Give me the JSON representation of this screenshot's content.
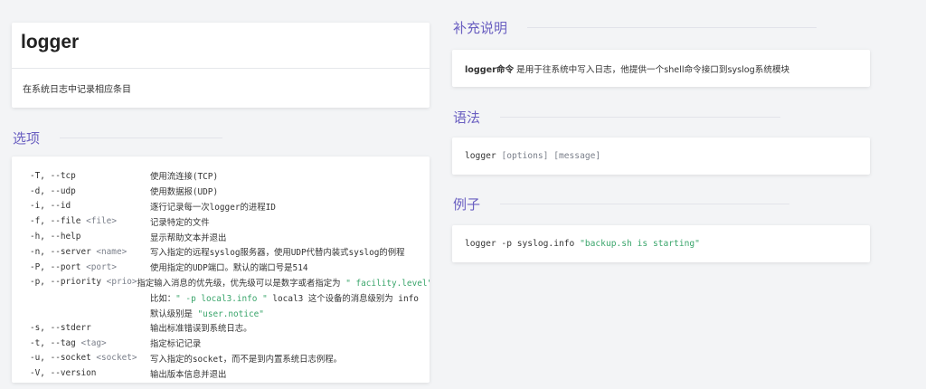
{
  "command": {
    "name": "logger",
    "description": "在系统日志中记录相应条目"
  },
  "sections": {
    "options": "选项",
    "supplement": "补充说明",
    "syntax": "语法",
    "example": "例子"
  },
  "supplement": {
    "bold": "logger命令",
    "text": " 是用于往系统中写入日志，他提供一个shell命令接口到syslog系统模块"
  },
  "syntax": {
    "cmd": "logger ",
    "arg1": "[options]",
    "sep": " ",
    "arg2": "[message]"
  },
  "example": {
    "cmd": "logger -p syslog.info ",
    "str": "\"backup.sh is starting\""
  },
  "options": [
    {
      "flag": "-T, --tcp",
      "arg": "",
      "text": "使用流连接(TCP)"
    },
    {
      "flag": "-d, --udp",
      "arg": "",
      "text": "使用数据报(UDP)"
    },
    {
      "flag": "-i, --id",
      "arg": "",
      "text": "逐行记录每一次logger的进程ID"
    },
    {
      "flag": "-f, --file ",
      "arg": "<file>",
      "text": "记录特定的文件"
    },
    {
      "flag": "-h, --help",
      "arg": "",
      "text": "显示帮助文本并退出"
    },
    {
      "flag": "-n, --server ",
      "arg": "<name>",
      "text": "写入指定的远程syslog服务器，使用UDP代替内装式syslog的例程"
    },
    {
      "flag": "-P, --port ",
      "arg": "<port>",
      "text": "使用指定的UDP端口。默认的端口号是514"
    },
    {
      "flag": "-p, --priority ",
      "arg": "<prio>",
      "text": "指定输入消息的优先级，优先级可以是数字或者指定为 ",
      "str": "\" facility.level\""
    },
    {
      "flag": "",
      "arg": "",
      "text": "比如：",
      "str": "\" -p local3.info \"",
      "text2": " local3 这个设备的消息级别为 info"
    },
    {
      "flag": "",
      "arg": "",
      "text": "默认级别是 ",
      "str": "\"user.notice\""
    },
    {
      "flag": "-s, --stderr",
      "arg": "",
      "text": "输出标准错误到系统日志。"
    },
    {
      "flag": "-t, --tag ",
      "arg": "<tag>",
      "text": "指定标记记录"
    },
    {
      "flag": "-u, --socket ",
      "arg": "<socket>",
      "text": "写入指定的socket，而不是到内置系统日志例程。"
    },
    {
      "flag": "-V, --version",
      "arg": "",
      "text": "输出版本信息并退出"
    }
  ],
  "colors": {
    "accent": "#6a5fc1",
    "string": "#3aa56b",
    "placeholder": "#7a7f8a",
    "background": "#f3f4f6"
  }
}
